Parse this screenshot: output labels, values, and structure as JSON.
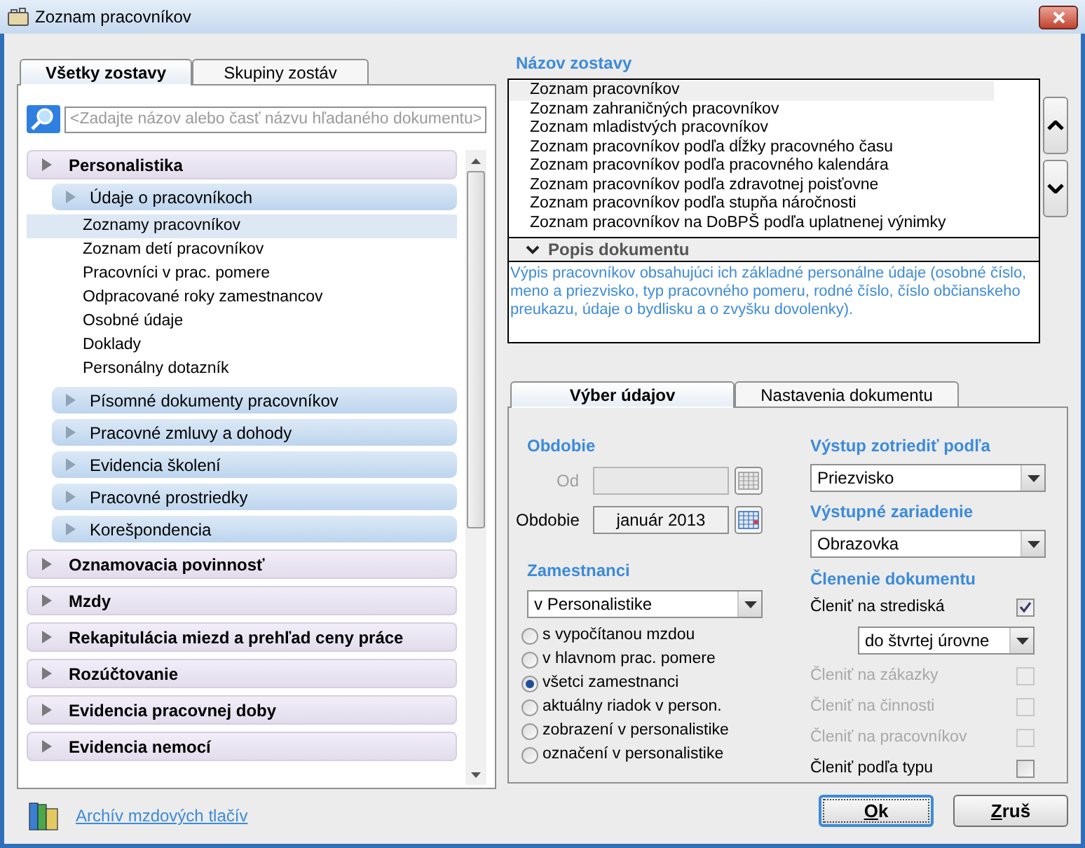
{
  "window": {
    "title": "Zoznam pracovníkov"
  },
  "left_tabs": [
    {
      "label": "Všetky zostavy",
      "selected": true
    },
    {
      "label": "Skupiny zostáv",
      "selected": false
    }
  ],
  "search": {
    "placeholder": "<Zadajte názov alebo časť názvu hľadaného dokumentu>"
  },
  "tree": [
    {
      "label": "Personalistika",
      "children": [
        {
          "label": "Údaje o pracovníkoch",
          "children": [
            {
              "label": "Zoznamy pracovníkov",
              "selected": true
            },
            {
              "label": "Zoznam detí pracovníkov",
              "selected": false
            },
            {
              "label": "Pracovníci v prac. pomere",
              "selected": false
            },
            {
              "label": "Odpracované roky zamestnancov",
              "selected": false
            },
            {
              "label": "Osobné údaje",
              "selected": false
            },
            {
              "label": "Doklady",
              "selected": false
            },
            {
              "label": "Personálny dotazník",
              "selected": false
            }
          ]
        },
        {
          "label": "Písomné dokumenty pracovníkov"
        },
        {
          "label": "Pracovné zmluvy a dohody"
        },
        {
          "label": "Evidencia školení"
        },
        {
          "label": "Pracovné prostriedky"
        },
        {
          "label": "Korešpondencia"
        }
      ]
    },
    {
      "label": "Oznamovacia povinnosť"
    },
    {
      "label": "Mzdy"
    },
    {
      "label": "Rekapitulácia miezd a prehľad ceny práce"
    },
    {
      "label": "Rozúčtovanie"
    },
    {
      "label": "Evidencia pracovnej doby"
    },
    {
      "label": "Evidencia nemocí"
    }
  ],
  "archive_link": "Archív mzdových tlačív",
  "report_list": {
    "title": "Názov zostavy",
    "items": [
      {
        "label": "Zoznam pracovníkov",
        "selected": true
      },
      {
        "label": "Zoznam zahraničných pracovníkov",
        "selected": false
      },
      {
        "label": "Zoznam mladistvých pracovníkov",
        "selected": false
      },
      {
        "label": "Zoznam pracovníkov podľa dĺžky pracovného času",
        "selected": false
      },
      {
        "label": "Zoznam pracovníkov podľa pracovného kalendára",
        "selected": false
      },
      {
        "label": "Zoznam pracovníkov podľa zdravotnej poisťovne",
        "selected": false
      },
      {
        "label": "Zoznam pracovníkov podľa stupňa náročnosti",
        "selected": false
      },
      {
        "label": "Zoznam pracovníkov na DoBPŠ podľa uplatnenej výnimky",
        "selected": false
      }
    ]
  },
  "description": {
    "title": "Popis dokumentu",
    "text": "Výpis pracovníkov obsahujúci ich základné personálne údaje (osobné číslo, meno a priezvisko, typ pracovného pomeru, rodné číslo, číslo občianskeho preukazu, údaje o bydlisku a o zvyšku dovolenky)."
  },
  "form_tabs": [
    {
      "label": "Výber údajov",
      "selected": true
    },
    {
      "label": "Nastavenia dokumentu",
      "selected": false
    }
  ],
  "period": {
    "title": "Obdobie",
    "fields": [
      {
        "label": "Od",
        "disabled": true
      },
      {
        "label": "Obdobie",
        "value": "január 2013",
        "disabled": false
      }
    ]
  },
  "employees": {
    "title": "Zamestnanci",
    "select": "v Personalistike",
    "radios": [
      {
        "label": "s vypočítanou mzdou",
        "selected": false
      },
      {
        "label": "v hlavnom prac. pomere",
        "selected": false
      },
      {
        "label": "všetci zamestnanci",
        "selected": true
      },
      {
        "label": "aktuálny riadok v person.",
        "selected": false
      },
      {
        "label": "zobrazení v personalistike",
        "selected": false
      },
      {
        "label": "označení v personalistike",
        "selected": false
      }
    ]
  },
  "sort": {
    "title": "Výstup zotriediť podľa",
    "value": "Priezvisko"
  },
  "output": {
    "title": "Výstupné zariadenie",
    "value": "Obrazovka"
  },
  "breakdown": {
    "title": "Členenie dokumentu",
    "items": [
      {
        "kind": "checkbox",
        "label": "Členiť na strediská",
        "checked": true,
        "disabled": false
      },
      {
        "kind": "select",
        "value": "do štvrtej úrovne"
      },
      {
        "kind": "checkbox",
        "label": "Členiť na zákazky",
        "checked": false,
        "disabled": true
      },
      {
        "kind": "checkbox",
        "label": "Členiť na činnosti",
        "checked": false,
        "disabled": true
      },
      {
        "kind": "checkbox",
        "label": "Členiť na pracovníkov",
        "checked": false,
        "disabled": true
      },
      {
        "kind": "checkbox",
        "label": "Členiť podľa typu",
        "checked": false,
        "disabled": false
      }
    ]
  },
  "buttons": [
    {
      "label": "Ok",
      "default": true
    },
    {
      "label": "Zruš",
      "default": false
    }
  ]
}
